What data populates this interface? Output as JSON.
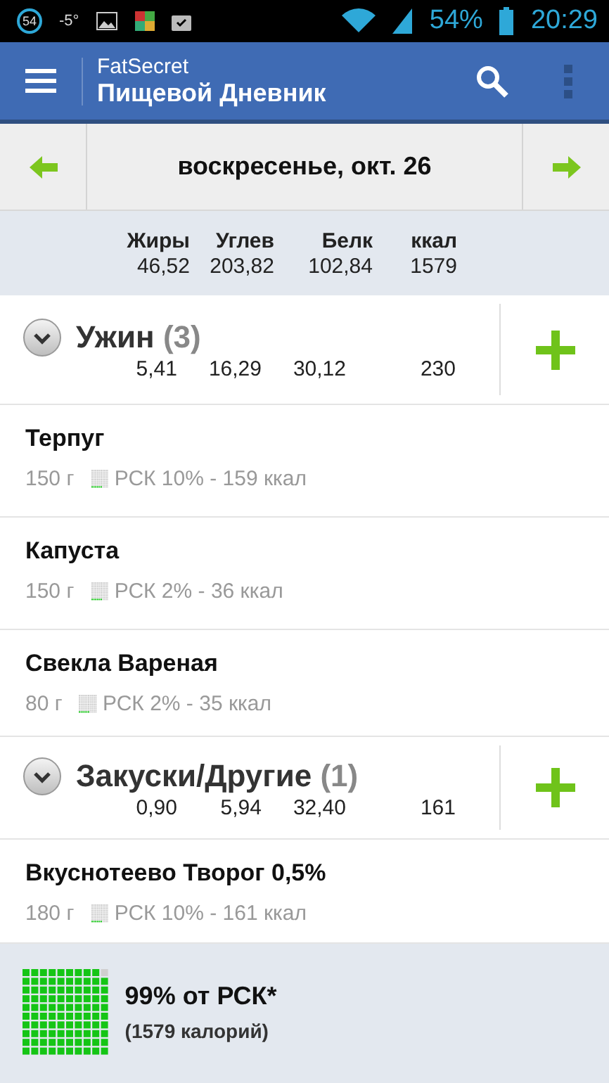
{
  "status_bar": {
    "badge": "54",
    "temperature": "-5°",
    "battery": "54%",
    "time": "20:29"
  },
  "app_bar": {
    "app_name": "FatSecret",
    "title": "Пищевой Дневник"
  },
  "date_nav": {
    "date": "воскресенье, окт. 26"
  },
  "totals": {
    "columns": [
      "Жиры",
      "Углев",
      "Белк",
      "ккал"
    ],
    "values": [
      "46,52",
      "203,82",
      "102,84",
      "1579"
    ]
  },
  "meals": [
    {
      "name": "Ужин",
      "count": "(3)",
      "values": [
        "5,41",
        "16,29",
        "30,12",
        "230"
      ],
      "items": [
        {
          "name": "Терпуг",
          "amount": "150 г",
          "rsk": "РСК 10% - 159 ккал"
        },
        {
          "name": "Капуста",
          "amount": "150 г",
          "rsk": "РСК 2% - 36 ккал"
        },
        {
          "name": "Свекла Вареная",
          "amount": "80 г",
          "rsk": "РСК 2% - 35 ккал"
        }
      ]
    },
    {
      "name": "Закуски/Другие",
      "count": "(1)",
      "values": [
        "0,90",
        "5,94",
        "32,40",
        "161"
      ],
      "items": [
        {
          "name": "Вкуснотеево Творог 0,5%",
          "amount": "180 г",
          "rsk": "РСК 10% - 161 ккал"
        }
      ]
    }
  ],
  "summary": {
    "percent": "99% от РСК*",
    "calories": "(1579 калорий)"
  }
}
